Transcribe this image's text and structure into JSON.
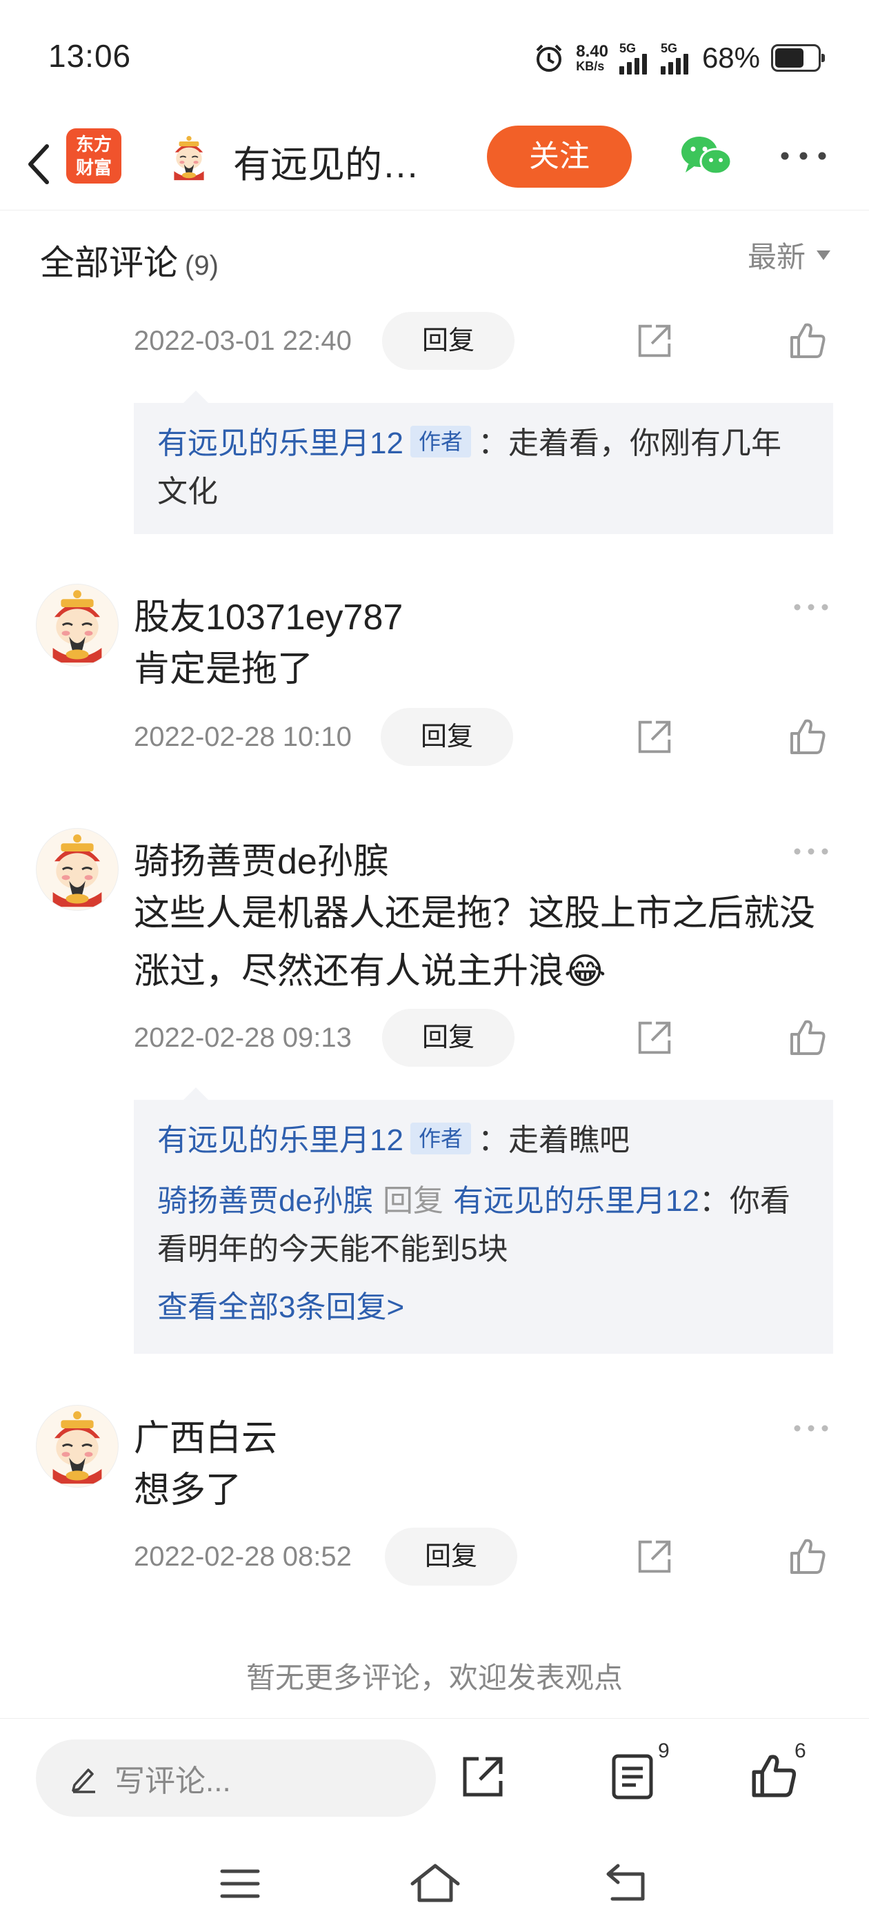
{
  "status_bar": {
    "time": "13:06",
    "net_speed_value": "8.40",
    "net_speed_unit": "KB/s",
    "sim1": "5G",
    "sim2": "5G",
    "battery_percent": "68%",
    "battery_level": 0.68
  },
  "header": {
    "app_logo_line1": "东方",
    "app_logo_line2": "财富",
    "title": "有远见的…",
    "follow_label": "关注",
    "accent_color": "#f26028"
  },
  "comments": {
    "title": "全部评论",
    "count": "(9)",
    "sort_label": "最新"
  },
  "thread_top": {
    "timestamp": "2022-03-01 22:40",
    "reply_label": "回复",
    "replies": [
      {
        "author": "有远见的乐里月12",
        "tag": "作者",
        "text": "：走着看，你刚有几年文化"
      }
    ]
  },
  "items": [
    {
      "username": "股友10371ey787",
      "text": "肯定是拖了",
      "timestamp": "2022-02-28 10:10",
      "reply_label": "回复"
    },
    {
      "username": "骑扬善贾de孙膑",
      "text": "这些人是机器人还是拖？这股上市之后就没涨过，尽然还有人说主升浪😂",
      "timestamp": "2022-02-28 09:13",
      "reply_label": "回复",
      "replies": [
        {
          "author": "有远见的乐里月12",
          "tag": "作者",
          "text": "：走着瞧吧"
        },
        {
          "author": "骑扬善贾de孙膑",
          "reply_word": "回复",
          "target": "有远见的乐里月12",
          "text": "：你看看明年的今天能不能到5块"
        }
      ],
      "view_all": "查看全部3条回复>"
    },
    {
      "username": "广西白云",
      "text": "想多了",
      "timestamp": "2022-02-28 08:52",
      "reply_label": "回复"
    }
  ],
  "no_more": "暂无更多评论，欢迎发表观点",
  "bottom_bar": {
    "input_placeholder": "写评论...",
    "comments_badge": "9",
    "likes_badge": "6"
  }
}
